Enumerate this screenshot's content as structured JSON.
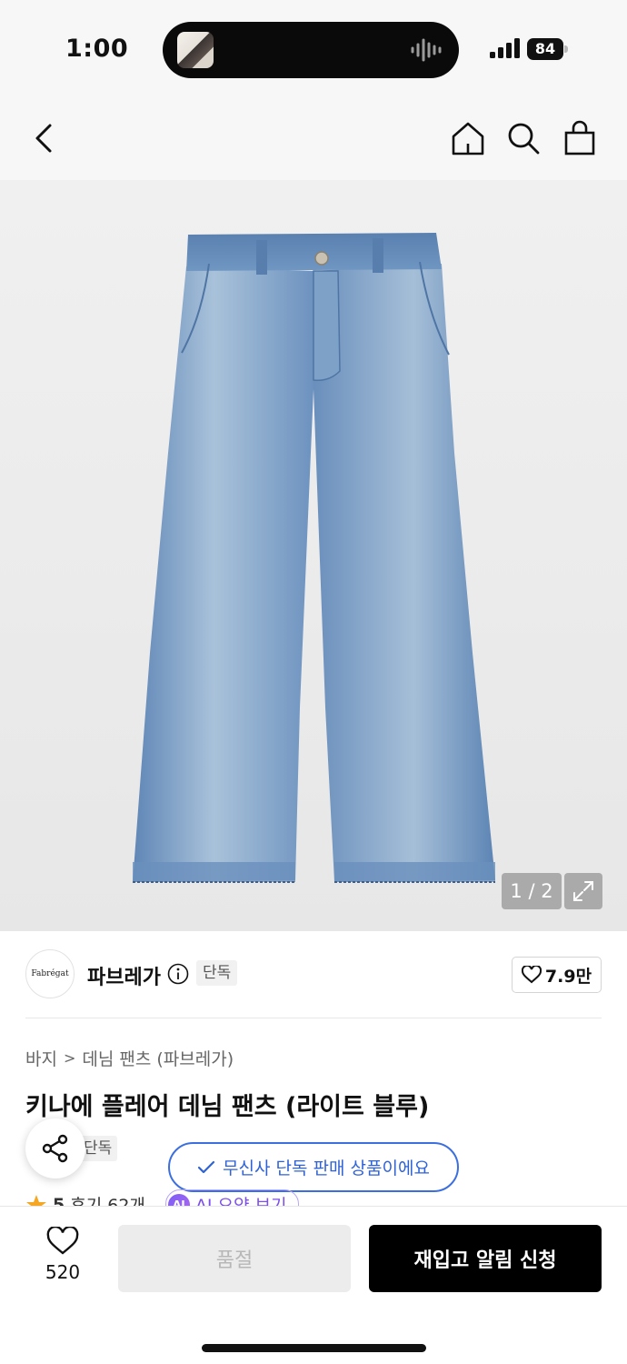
{
  "status_bar": {
    "time": "1:00",
    "battery": "84"
  },
  "nav": {
    "back_icon": "chevron-left-icon",
    "home_icon": "home-icon",
    "search_icon": "search-icon",
    "bag_icon": "shopping-bag-icon"
  },
  "gallery": {
    "pager": "1 / 2",
    "expand_icon": "expand-icon"
  },
  "brand": {
    "logo_text": "Fabrégat",
    "name": "파브레가",
    "badge": "단독",
    "likes": "7.9만"
  },
  "product": {
    "breadcrumb": [
      "바지",
      "데님 팬츠 (파브레가)"
    ],
    "title": "키나에 플레어 데님 팬츠 (라이트 블루)",
    "tag": "단독",
    "toast": "무신사 단독 판매 상품이에요",
    "rating": "5",
    "reviews": "후기 62개",
    "ai_badge": "AI",
    "ai_summary": "AI 요약 보기"
  },
  "bottom_bar": {
    "wish_count": "520",
    "soldout_label": "품절",
    "restock_label": "재입고 알림 신청"
  },
  "colors": {
    "accent_blue": "#2f62d6",
    "denim": "#6f95c0",
    "black": "#000000"
  }
}
